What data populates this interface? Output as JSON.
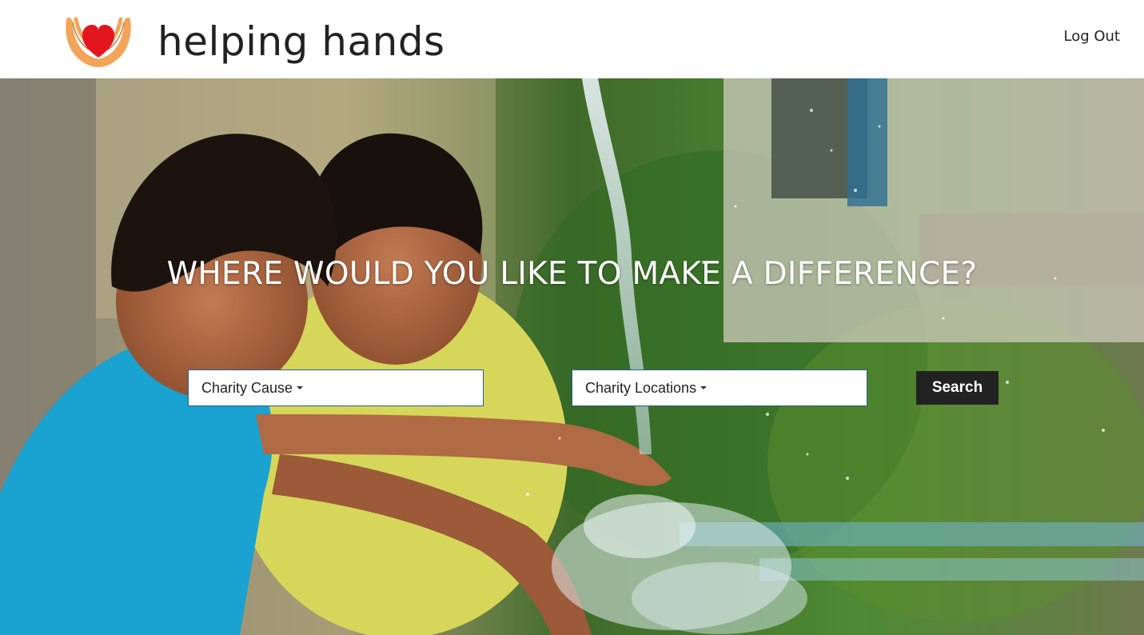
{
  "header": {
    "brand": "helping hands",
    "logout_label": "Log Out",
    "logo_icon": "heart-in-hands-icon"
  },
  "hero": {
    "headline": "WHERE WOULD YOU LIKE TO MAKE A DIFFERENCE?",
    "background_image": "children-splashing-water-photo",
    "cause_dropdown": {
      "label": "Charity Cause",
      "icon": "caret-down-icon"
    },
    "location_dropdown": {
      "label": "Charity Locations",
      "icon": "caret-down-icon"
    },
    "search_label": "Search"
  },
  "colors": {
    "heart": "#e3161f",
    "hands": "#f2a55a",
    "button": "#222222",
    "dropdown_border": "#2a5d8f"
  }
}
